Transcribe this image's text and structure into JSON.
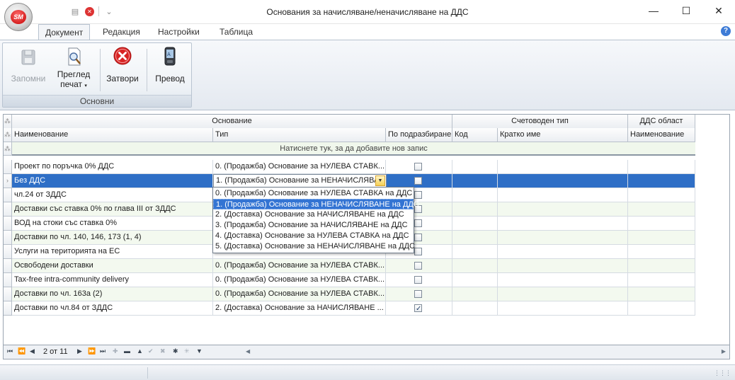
{
  "app": {
    "logo": "SM",
    "title": "Основания за начисляване/неначисляване на ДДС"
  },
  "ribbon": {
    "tabs": [
      {
        "label": "Документ",
        "active": true
      },
      {
        "label": "Редакция",
        "active": false
      },
      {
        "label": "Настройки",
        "active": false
      },
      {
        "label": "Таблица",
        "active": false
      }
    ],
    "group_label": "Основни",
    "buttons": {
      "save": "Запомни",
      "preview_line1": "Преглед",
      "preview_line2": "печат",
      "close": "Затвори",
      "translate": "Превод"
    }
  },
  "grid": {
    "bands": {
      "basis": "Основание",
      "accounting_type": "Счетоводен тип",
      "vat_area": "ДДС област"
    },
    "columns": {
      "name": "Наименование",
      "type": "Тип",
      "default": "По подразбиране",
      "code": "Код",
      "short_name": "Кратко име",
      "vat_name": "Наименование"
    },
    "new_row_prompt": "Натиснете тук, за да добавите нов запис",
    "rows": [
      {
        "name": "Проект по поръчка 0% ДДС",
        "type": "0. (Продажба) Основание за НУЛЕВА СТАВК...",
        "default": false
      },
      {
        "name": "Без ДДС",
        "type": "1. (Продажба) Основание за НЕНАЧИСЛЯВА",
        "default": false
      },
      {
        "name": "чл.24 от ЗДДС",
        "type": "",
        "default": false
      },
      {
        "name": "Доставки със ставка 0% по глава III от ЗДДС",
        "type": "",
        "default": false
      },
      {
        "name": "ВОД на стоки със ставка 0%",
        "type": "",
        "default": false
      },
      {
        "name": "Доставки по чл. 140, 146, 173 (1, 4)",
        "type": "",
        "default": false
      },
      {
        "name": "Услуги на територията на ЕС",
        "type": "",
        "default": false
      },
      {
        "name": "Освободени доставки",
        "type": "0. (Продажба) Основание за НУЛЕВА СТАВК...",
        "default": false
      },
      {
        "name": "Tax-free intra-community delivery",
        "type": "0. (Продажба) Основание за НУЛЕВА СТАВК...",
        "default": false
      },
      {
        "name": "Доставки по чл. 163а (2)",
        "type": "0. (Продажба) Основание за НУЛЕВА СТАВК...",
        "default": false
      },
      {
        "name": "Доставки по чл.84 от ЗДДС",
        "type": "2. (Доставка) Основание за НАЧИСЛЯВАНЕ ...",
        "default": true
      }
    ],
    "dropdown_options": [
      "0. (Продажба) Основание за НУЛЕВА СТАВКА на ДДС",
      "1. (Продажба) Основание за НЕНАЧИСЛЯВАНЕ на ДДС",
      "2. (Доставка) Основание за НАЧИСЛЯВАНЕ на ДДС",
      "3. (Продажба) Основание за НАЧИСЛЯВАНЕ на ДДС",
      "4. (Доставка) Основание за  НУЛЕВА СТАВКА на ДДС",
      "5. (Доставка) Основание за НЕНАЧИСЛЯВАНЕ на ДДС"
    ],
    "dropdown_selected": 1,
    "selected_row": 1
  },
  "navigator": {
    "position": "2 от 11"
  },
  "colors": {
    "selection": "#2f6fc6",
    "alt_row": "#f3f9ef",
    "new_row": "#f0f7ec"
  }
}
